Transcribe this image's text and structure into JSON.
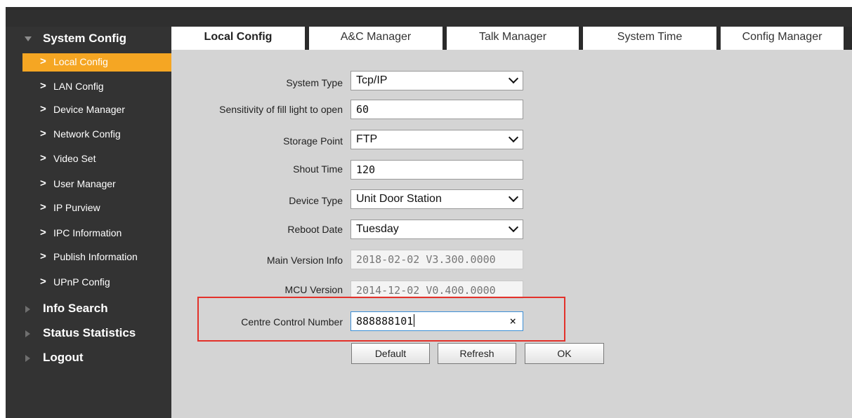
{
  "sidebar": {
    "system_config": "System Config",
    "items": [
      {
        "label": "Local Config",
        "active": true
      },
      {
        "label": "LAN Config"
      },
      {
        "label": "Device Manager"
      },
      {
        "label": "Network Config"
      },
      {
        "label": "Video Set"
      },
      {
        "label": "User Manager"
      },
      {
        "label": "IP Purview"
      },
      {
        "label": "IPC Information"
      },
      {
        "label": "Publish Information"
      },
      {
        "label": "UPnP Config"
      }
    ],
    "info_search": "Info Search",
    "status_statistics": "Status Statistics",
    "logout": "Logout",
    "chevron": ">"
  },
  "tabs": [
    "Local Config",
    "A&C Manager",
    "Talk Manager",
    "System Time",
    "Config Manager"
  ],
  "form": {
    "system_type": {
      "label": "System Type",
      "value": "Tcp/IP"
    },
    "fill_light": {
      "label": "Sensitivity of fill light to open",
      "value": "60"
    },
    "storage_point": {
      "label": "Storage Point",
      "value": "FTP"
    },
    "shout_time": {
      "label": "Shout Time",
      "value": "120"
    },
    "device_type": {
      "label": "Device Type",
      "value": "Unit Door Station"
    },
    "reboot_date": {
      "label": "Reboot Date",
      "value": "Tuesday"
    },
    "main_version": {
      "label": "Main Version Info",
      "value": "2018-02-02 V3.300.0000"
    },
    "mcu_version": {
      "label": "MCU Version",
      "value": "2014-12-02 V0.400.0000"
    },
    "centre_control": {
      "label": "Centre Control Number",
      "value": "888888101",
      "clear": "×"
    }
  },
  "buttons": {
    "default": "Default",
    "refresh": "Refresh",
    "ok": "OK"
  },
  "colors": {
    "active": "#f5a623",
    "highlight": "#e3312a"
  }
}
